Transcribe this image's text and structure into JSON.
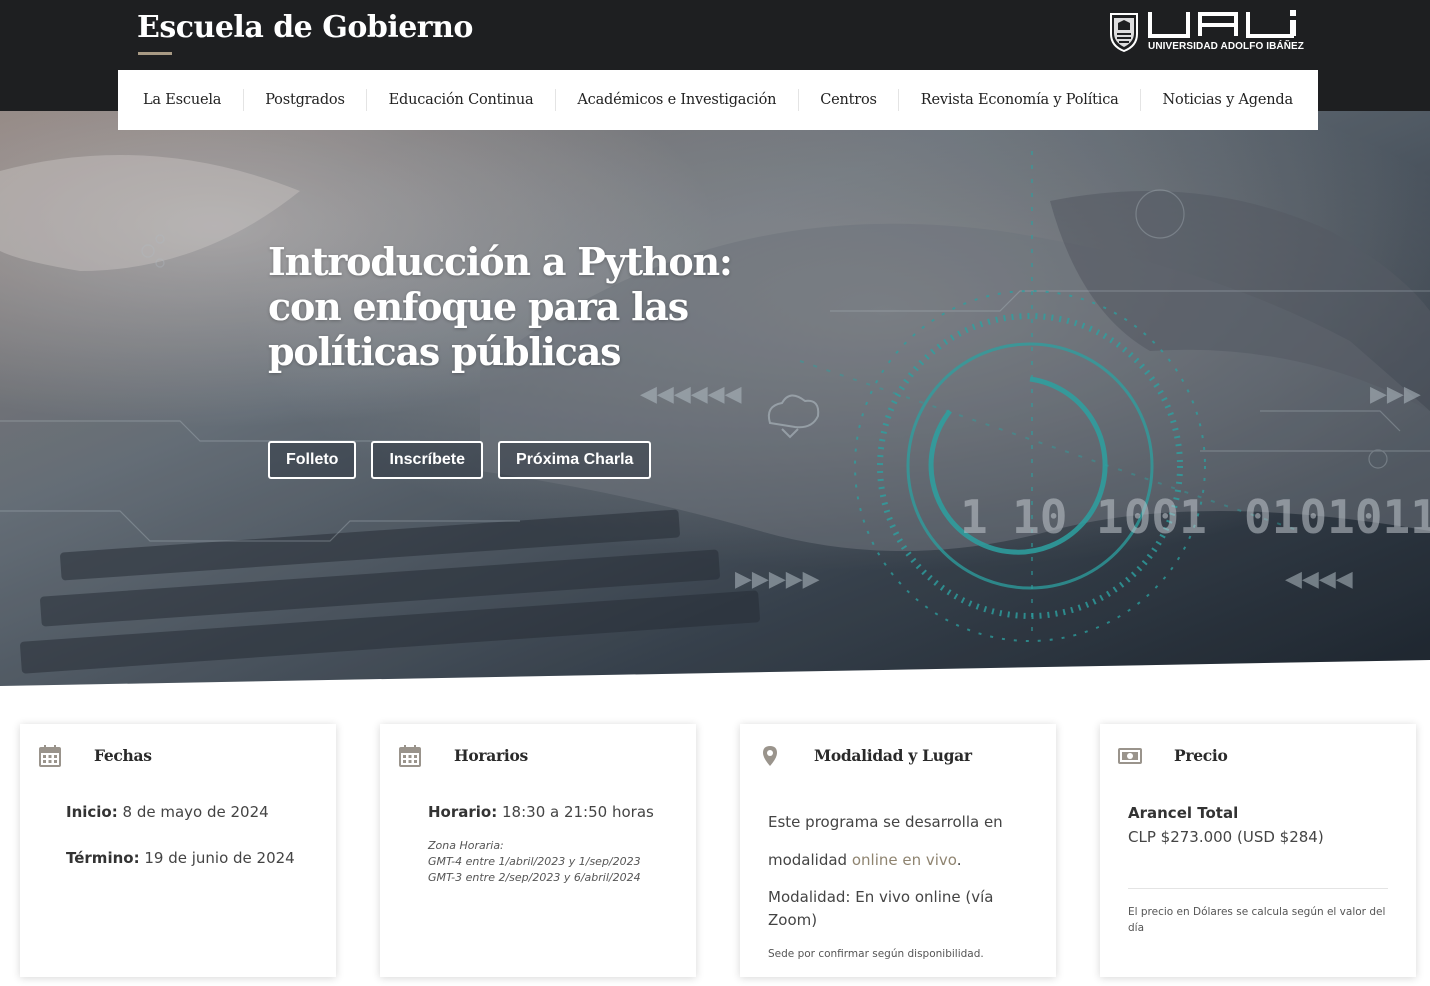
{
  "header": {
    "site_title": "Escuela de Gobierno",
    "logo_text": "UNIVERSIDAD ADOLFO IBÁÑEZ",
    "logo_mark": "UAI"
  },
  "nav": {
    "items": [
      {
        "label": "La Escuela"
      },
      {
        "label": "Postgrados"
      },
      {
        "label": "Educación Continua"
      },
      {
        "label": "Académicos e Investigación"
      },
      {
        "label": "Centros"
      },
      {
        "label": "Revista Economía y Política"
      },
      {
        "label": "Noticias y Agenda"
      }
    ]
  },
  "hero": {
    "title": "Introducción a Python: con enfoque para las políticas públicas",
    "buttons": [
      "Folleto",
      "Inscríbete",
      "Próxima Charla"
    ],
    "background_numbers": [
      "1",
      "10",
      "1001",
      "0101011"
    ]
  },
  "cards": {
    "fechas": {
      "title": "Fechas",
      "icon": "calendar-icon",
      "inicio_label": "Inicio:",
      "inicio_value": "8 de mayo de 2024",
      "termino_label": "Término:",
      "termino_value": "19 de junio de 2024"
    },
    "horarios": {
      "title": "Horarios",
      "icon": "calendar-icon",
      "horario_label": "Horario:",
      "horario_value": "18:30 a 21:50 horas",
      "zona_label": "Zona Horaria:",
      "zona_line1": "GMT-4 entre 1/abril/2023 y 1/sep/2023",
      "zona_line2": "GMT-3 entre 2/sep/2023 y 6/abril/2024"
    },
    "modalidad": {
      "title": "Modalidad y Lugar",
      "icon": "location-pin-icon",
      "line1": "Este programa se desarrolla en",
      "line2_prefix": "modalidad",
      "line2_link": "online en vivo",
      "line2_suffix": ".",
      "modalidad_text": "Modalidad: En vivo online (vía Zoom)",
      "sede_note": "Sede por confirmar según disponibilidad."
    },
    "precio": {
      "title": "Precio",
      "icon": "money-icon",
      "arancel_label": "Arancel Total",
      "arancel_value": "CLP $273.000 (USD $284)",
      "note": "El precio en Dólares se calcula según el valor del día"
    }
  },
  "colors": {
    "header_bg": "#1e1f21",
    "accent": "#a89a84",
    "link_accent": "#8f8470",
    "hero_teal": "#2fb3b0",
    "icon_gray": "#9a948c"
  }
}
